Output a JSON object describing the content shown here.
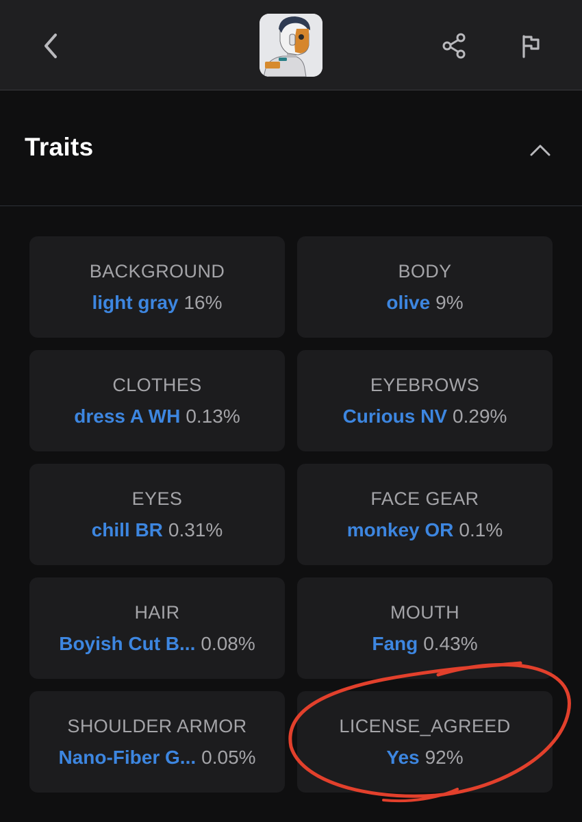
{
  "header": {
    "back_icon": "chevron-left-icon",
    "avatar_icon": "nft-avatar-image",
    "share_icon": "share-icon",
    "flag_icon": "flag-icon"
  },
  "traits": {
    "title": "Traits",
    "collapse_icon": "chevron-up-icon",
    "items": [
      {
        "label": "BACKGROUND",
        "value": "light gray",
        "percent": "16%"
      },
      {
        "label": "BODY",
        "value": "olive",
        "percent": "9%"
      },
      {
        "label": "CLOTHES",
        "value": "dress A WH",
        "percent": "0.13%"
      },
      {
        "label": "EYEBROWS",
        "value": "Curious NV",
        "percent": "0.29%"
      },
      {
        "label": "EYES",
        "value": "chill BR",
        "percent": "0.31%"
      },
      {
        "label": "FACE GEAR",
        "value": "monkey OR",
        "percent": "0.1%"
      },
      {
        "label": "HAIR",
        "value": "Boyish Cut B...",
        "percent": "0.08%"
      },
      {
        "label": "MOUTH",
        "value": "Fang",
        "percent": "0.43%"
      },
      {
        "label": "SHOULDER ARMOR",
        "value": "Nano-Fiber G...",
        "percent": "0.05%"
      },
      {
        "label": "LICENSE_AGREED",
        "value": "Yes",
        "percent": "92%"
      }
    ]
  },
  "colors": {
    "accent": "#3d86e0",
    "annotation": "#e2402c",
    "card_bg": "#1c1c1e",
    "page_bg": "#0f0f10"
  }
}
